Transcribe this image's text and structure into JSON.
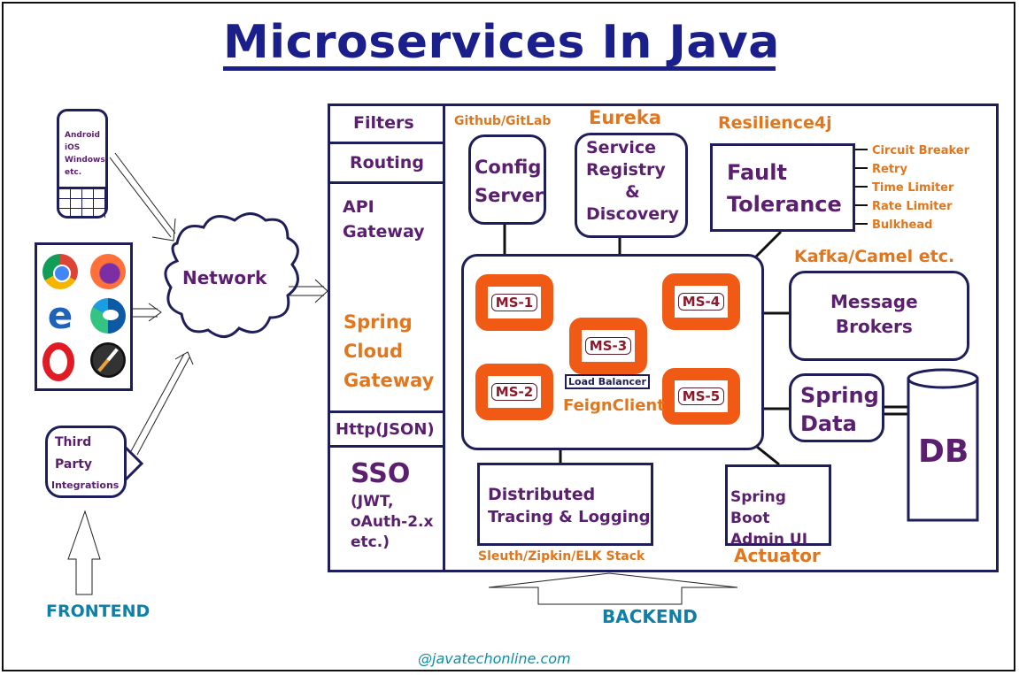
{
  "title": "Microservices In Java",
  "frontend": {
    "label": "FRONTEND",
    "mobile_device_lines": [
      "Android",
      "iOS",
      "Windows",
      "etc."
    ],
    "browsers": [
      "chrome-icon",
      "firefox-icon",
      "ie-icon",
      "edge-icon",
      "opera-icon",
      "safari-icon"
    ],
    "third_party_lines": [
      "Third",
      "Party",
      "Integrations"
    ],
    "network_label": "Network"
  },
  "gateway": {
    "filters": "Filters",
    "routing": "Routing",
    "api_gateway_lines": [
      "API",
      "Gateway"
    ],
    "spring_cloud_lines": [
      "Spring",
      "Cloud",
      "Gateway"
    ],
    "http_json": "Http(JSON)",
    "sso": "SSO",
    "sso_detail_lines": [
      "(JWT,",
      "oAuth-2.x",
      "etc.)"
    ]
  },
  "backend": {
    "label": "BACKEND",
    "config_server": {
      "caption": "Github/GitLab",
      "lines": [
        "Config",
        "Server"
      ]
    },
    "service_registry": {
      "caption": "Eureka",
      "lines": [
        "Service",
        "Registry",
        "&",
        "Discovery"
      ]
    },
    "fault_tolerance": {
      "caption": "Resilience4j",
      "lines": [
        "Fault",
        "Tolerance"
      ],
      "patterns": [
        "Circuit Breaker",
        "Retry",
        "Time Limiter",
        "Rate Limiter",
        "Bulkhead"
      ]
    },
    "microservices": [
      "MS-1",
      "MS-2",
      "MS-3",
      "MS-4",
      "MS-5"
    ],
    "load_balancer": "Load Balancer",
    "feign_client": "FeignClient",
    "message_brokers": {
      "caption": "Kafka/Camel etc.",
      "lines": [
        "Message",
        "Brokers"
      ]
    },
    "spring_data": [
      "Spring",
      "Data"
    ],
    "db": "DB",
    "distributed_tracing": {
      "lines": [
        "Distributed",
        "Tracing & Logging"
      ],
      "caption": "Sleuth/Zipkin/ELK Stack"
    },
    "admin_ui": {
      "lines": [
        "Spring Boot",
        "Admin UI"
      ],
      "caption": "Actuator"
    }
  },
  "footer": {
    "website": "@javatechonline.com"
  },
  "colors": {
    "title": "#1a1f8c",
    "label_purple": "#5a1f6e",
    "caption_orange": "#e0761e",
    "ms_border": "#f05a14",
    "box_border": "#1e1e5a",
    "section_teal": "#0e7fa6"
  }
}
